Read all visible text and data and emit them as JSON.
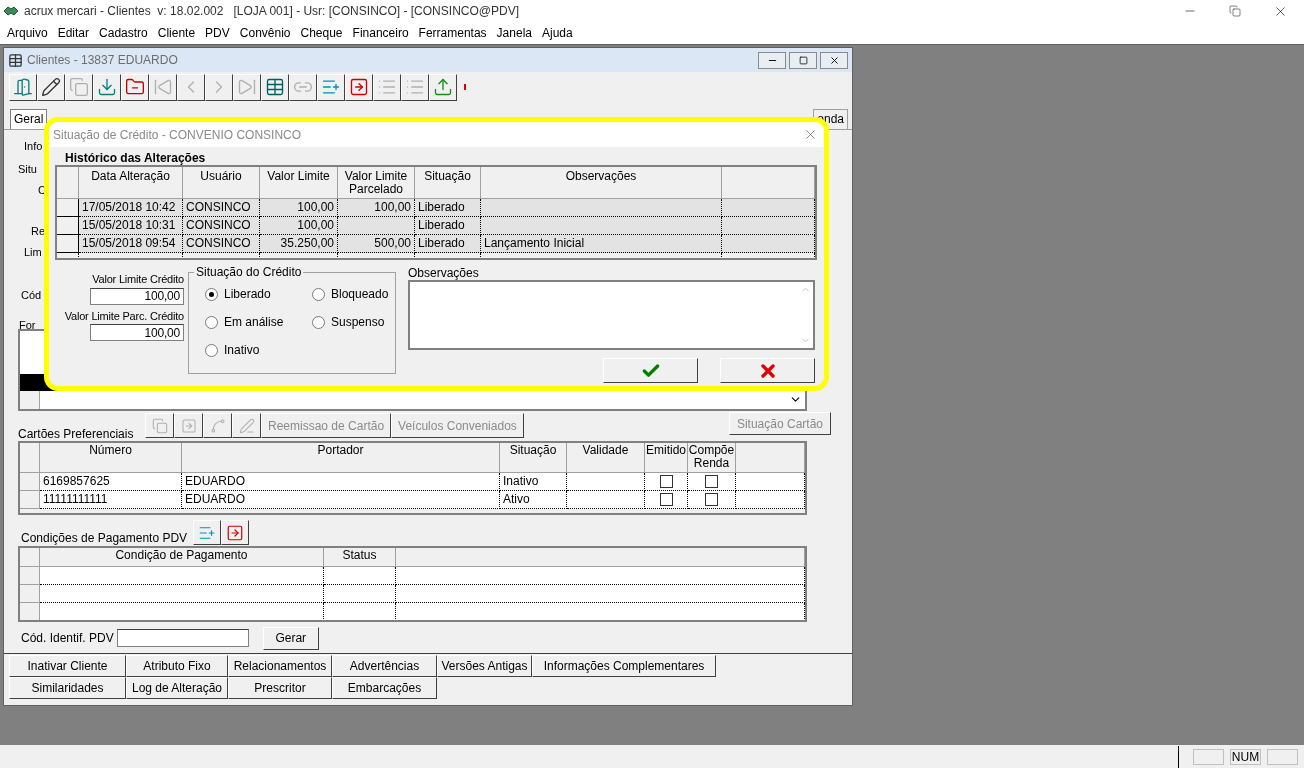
{
  "app": {
    "title": "acrux mercari - Clientes  v: 18.02.002   [LOJA 001] - Usr: [CONSINCO] - [CONSINCO@PDV]"
  },
  "menu": [
    "Arquivo",
    "Editar",
    "Cadastro",
    "Cliente",
    "PDV",
    "Convênio",
    "Cheque",
    "Financeiro",
    "Ferramentas",
    "Janela",
    "Ajuda"
  ],
  "child_window": {
    "title": "Clientes - 13837 EDUARDO",
    "toolbar": [
      {
        "kind": "exit",
        "disabled": false
      },
      {
        "kind": "edit",
        "disabled": false
      },
      {
        "kind": "copy",
        "disabled": true
      },
      {
        "kind": "save",
        "disabled": false
      },
      {
        "kind": "delete",
        "disabled": false
      },
      {
        "kind": "first",
        "disabled": true
      },
      {
        "kind": "previous",
        "disabled": true
      },
      {
        "kind": "next",
        "disabled": true
      },
      {
        "kind": "last",
        "disabled": true
      },
      {
        "kind": "grid",
        "disabled": false
      },
      {
        "kind": "link",
        "disabled": true
      },
      {
        "kind": "add",
        "disabled": false
      },
      {
        "kind": "remove",
        "disabled": false
      },
      {
        "kind": "list",
        "disabled": true
      },
      {
        "kind": "list",
        "disabled": true
      },
      {
        "kind": "upload",
        "disabled": false
      }
    ],
    "tabs": [
      {
        "label": "Geral",
        "selected": true
      },
      {
        "label": "onda",
        "selected": false
      }
    ],
    "clipped_labels": [
      "Info",
      "Situ",
      "C",
      "Re",
      "Lim",
      "Cód",
      "For"
    ],
    "cards": {
      "title": "Cartões Preferenciais",
      "tools": [
        {
          "kind": "copy",
          "disabled": true
        },
        {
          "kind": "move",
          "disabled": true
        },
        {
          "kind": "curve",
          "disabled": true
        },
        {
          "kind": "pencil",
          "disabled": true
        }
      ],
      "buttons": [
        {
          "label": "Reemissao de Cartão",
          "disabled": true
        },
        {
          "label": "Veículos Conveniados",
          "disabled": true
        }
      ],
      "status_button": {
        "label": "Situação Cartão",
        "disabled": true
      },
      "columns": [
        "Número",
        "Portador",
        "Situação",
        "Validade",
        "Emitido",
        "Compõe Renda"
      ],
      "rows": [
        {
          "numero": "6169857625",
          "portador": "EDUARDO",
          "situacao": "Inativo",
          "emitido": false,
          "compoe_renda": false
        },
        {
          "numero": "11111111111",
          "portador": "EDUARDO",
          "situacao": "Ativo",
          "emitido": false,
          "compoe_renda": false
        }
      ]
    },
    "payment": {
      "title": "Condições de Pagamento PDV",
      "tools": [
        {
          "kind": "add"
        },
        {
          "kind": "remove"
        }
      ],
      "columns": [
        "Condição de Pagamento",
        "Status"
      ]
    },
    "pdv_code": {
      "label": "Cód. Identif. PDV",
      "button": "Gerar"
    },
    "actions": [
      [
        "Inativar Cliente",
        "Atributo Fixo",
        "Relacionamentos",
        "Advertências",
        "Versões Antigas",
        "Informações Complementares"
      ],
      [
        "Similaridades",
        "Log de Alteração",
        "Prescritor",
        "Embarcações"
      ]
    ]
  },
  "dialog": {
    "title": "Situação de Crédito - CONVENIO CONSINCO",
    "history": {
      "title": "Histórico das Alterações",
      "columns": [
        "Data Alteração",
        "Usuário",
        "Valor Limite",
        "Valor Limite Parcelado",
        "Situação",
        "Observações"
      ],
      "rows": [
        {
          "data": "17/05/2018 10:42",
          "usuario": "CONSINCO",
          "valor_limite": "100,00",
          "valor_parcelado": "100,00",
          "situacao": "Liberado"
        },
        {
          "data": "15/05/2018 10:31",
          "usuario": "CONSINCO",
          "valor_limite": "100,00",
          "situacao": "Liberado"
        },
        {
          "data": "15/05/2018 09:54",
          "usuario": "CONSINCO",
          "valor_limite": "35.250,00",
          "valor_parcelado": "500,00",
          "situacao": "Liberado",
          "observacoes": "Lançamento Inicial"
        }
      ]
    },
    "limit": {
      "label": "Valor Limite Crédito",
      "value": "100,00"
    },
    "installment_limit": {
      "label": "Valor Limite Parc. Crédito",
      "value": "100,00"
    },
    "status_group": {
      "title": "Situação do Crédito",
      "options": [
        {
          "label": "Liberado",
          "selected": true
        },
        {
          "label": "Bloqueado",
          "selected": false
        },
        {
          "label": "Em análise",
          "selected": false
        },
        {
          "label": "Suspenso",
          "selected": false
        },
        {
          "label": "Inativo",
          "selected": false
        }
      ]
    },
    "notes": {
      "label": "Observações"
    }
  },
  "status_bar": {
    "num": "NUM"
  }
}
